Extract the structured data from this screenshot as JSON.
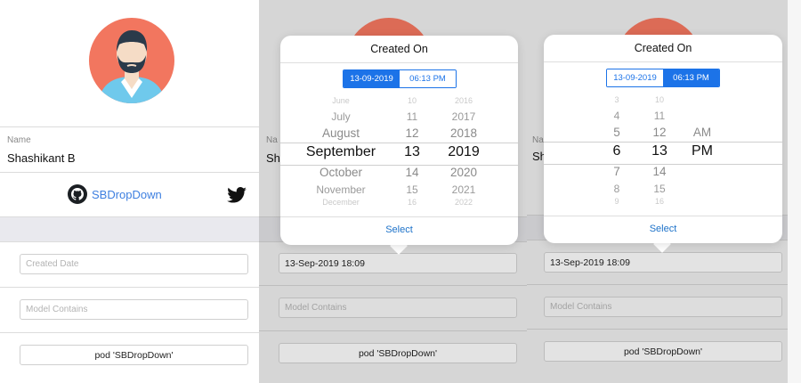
{
  "profile": {
    "name_label": "Name",
    "name_value": "Shashikant B",
    "name_value_short": "Sh",
    "name_label_short": "Na",
    "github_label": "SBDropDown",
    "github_icon": "github-icon",
    "twitter_icon": "twitter-icon"
  },
  "form": {
    "created_date_placeholder": "Created Date",
    "created_date_value": "13-Sep-2019 18:09",
    "model_placeholder": "Model Contains",
    "pod_text": "pod 'SBDropDown'"
  },
  "date_popover": {
    "title": "Created On",
    "seg_date": "13-09-2019",
    "seg_time": "06:13 PM",
    "active_segment": "date",
    "months": [
      "June",
      "July",
      "August",
      "September",
      "October",
      "November",
      "December"
    ],
    "days": [
      "10",
      "11",
      "12",
      "13",
      "14",
      "15",
      "16"
    ],
    "years": [
      "2016",
      "2017",
      "2018",
      "2019",
      "2020",
      "2021",
      "2022"
    ],
    "select_label": "Select"
  },
  "time_popover": {
    "title": "Created On",
    "seg_date": "13-09-2019",
    "seg_time": "06:13 PM",
    "active_segment": "time",
    "hours": [
      "3",
      "4",
      "5",
      "6",
      "7",
      "8",
      "9"
    ],
    "minutes": [
      "10",
      "11",
      "12",
      "13",
      "14",
      "15",
      "16"
    ],
    "ampm": [
      "AM",
      "PM"
    ],
    "select_label": "Select"
  },
  "colors": {
    "accent": "#1c73e8",
    "link": "#3d7fe0",
    "avatar_bg": "#f2765f"
  }
}
